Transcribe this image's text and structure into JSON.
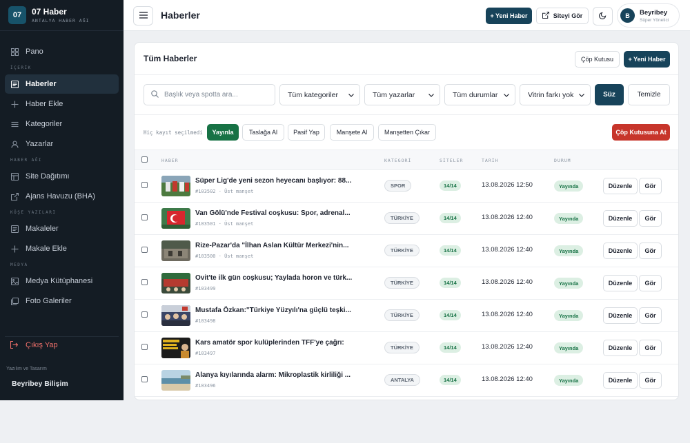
{
  "brand": {
    "logo": "07",
    "name": "07 Haber",
    "subtitle": "ANTALYA HABER AĞI"
  },
  "sidebar": {
    "items": [
      {
        "label": "Pano",
        "icon": "grid-icon",
        "active": false
      },
      {
        "section": "İÇERİK"
      },
      {
        "label": "Haberler",
        "icon": "document-icon",
        "active": true
      },
      {
        "label": "Haber Ekle",
        "icon": "plus-icon",
        "active": false
      },
      {
        "label": "Kategoriler",
        "icon": "list-icon",
        "active": false
      },
      {
        "label": "Yazarlar",
        "icon": "user-icon",
        "active": false
      },
      {
        "section": "HABER AĞI"
      },
      {
        "label": "Site Dağıtımı",
        "icon": "layout-icon",
        "active": false
      },
      {
        "label": "Ajans Havuzu (BHA)",
        "icon": "external-link-icon",
        "active": false
      },
      {
        "section": "KÖŞE YAZILARI"
      },
      {
        "label": "Makaleler",
        "icon": "document-icon",
        "active": false
      },
      {
        "label": "Makale Ekle",
        "icon": "plus-icon",
        "active": false
      },
      {
        "section": "MEDYA"
      },
      {
        "label": "Medya Kütüphanesi",
        "icon": "image-icon",
        "active": false
      },
      {
        "label": "Foto Galeriler",
        "icon": "gallery-icon",
        "active": false
      }
    ],
    "logout": "Çıkış Yap",
    "credit_label": "Yazılım ve Tasarım",
    "credit_name": "Beyribey Bilişim"
  },
  "topbar": {
    "title": "Haberler",
    "new_label": "+ Yeni Haber",
    "site_label": "Siteyi Gör",
    "user_initial": "B",
    "user_name": "Beyribey",
    "user_role": "Süper Yönetici"
  },
  "card": {
    "title": "Tüm Haberler",
    "trash_label": "Çöp Kutusu",
    "new_label": "+ Yeni Haber"
  },
  "filters": {
    "search_placeholder": "Başlık veya spotta ara...",
    "category": "Tüm kategoriler",
    "author": "Tüm yazarlar",
    "status": "Tüm durumlar",
    "showcase": "Vitrin farkı yok",
    "filter_label": "Süz",
    "clear_label": "Temizle"
  },
  "bulk": {
    "none_selected": "Hiç kayıt seçilmedi",
    "publish": "Yayınla",
    "draft": "Taslağa Al",
    "deactivate": "Pasif Yap",
    "headline": "Manşete Al",
    "unheadline": "Manşetten Çıkar",
    "trash": "Çöp Kutusuna At"
  },
  "table": {
    "headers": {
      "news": "HABER",
      "category": "KATEGORİ",
      "sites": "SİTELER",
      "date": "TARİH",
      "status": "DURUM"
    },
    "edit_label": "Düzenle",
    "view_label": "Gör",
    "rows": [
      {
        "title": "Süper Lig'de yeni sezon heyecanı başlıyor: 88...",
        "meta": "#103502 · Üst manşet",
        "category": "SPOR",
        "sites": "14/14",
        "date": "13.08.2026 12:50",
        "status": "Yayında"
      },
      {
        "title": "Van Gölü'nde Festival coşkusu: Spor, adrenal...",
        "meta": "#103501 · Üst manşet",
        "category": "TÜRKİYE",
        "sites": "14/14",
        "date": "13.08.2026 12:40",
        "status": "Yayında"
      },
      {
        "title": "Rize-Pazar'da \"İlhan Aslan Kültür Merkezi'nin...",
        "meta": "#103500 · Üst manşet",
        "category": "TÜRKİYE",
        "sites": "14/14",
        "date": "13.08.2026 12:40",
        "status": "Yayında"
      },
      {
        "title": "Ovit'te ilk gün coşkusu; Yaylada horon ve türk...",
        "meta": "#103499",
        "category": "TÜRKİYE",
        "sites": "14/14",
        "date": "13.08.2026 12:40",
        "status": "Yayında"
      },
      {
        "title": "Mustafa Özkan:\"Türkiye Yüzyılı'na güçlü teşki...",
        "meta": "#103498",
        "category": "TÜRKİYE",
        "sites": "14/14",
        "date": "13.08.2026 12:40",
        "status": "Yayında"
      },
      {
        "title": "Kars amatör spor kulüplerinden TFF'ye çağrı:",
        "meta": "#103497",
        "category": "TÜRKİYE",
        "sites": "14/14",
        "date": "13.08.2026 12:40",
        "status": "Yayında"
      },
      {
        "title": "Alanya kıyılarında alarm: Mikroplastik kirliliği ...",
        "meta": "#103496",
        "category": "ANTALYA",
        "sites": "14/14",
        "date": "13.08.2026 12:40",
        "status": "Yayında"
      }
    ]
  },
  "colors": {
    "accent": "#17435a",
    "success": "#177245",
    "danger": "#c7352b",
    "sidebar": "#141c24"
  }
}
